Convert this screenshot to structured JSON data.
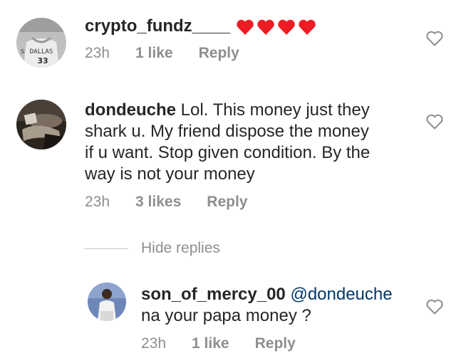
{
  "comments": [
    {
      "username": "crypto_fundz____",
      "text": "",
      "hearts": 4,
      "time": "23h",
      "likes": "1 like",
      "reply": "Reply",
      "avatar_text": "DALLAS 33",
      "avatar_text_small": "S",
      "avatar_number": "33",
      "avatar_team": "DALLAS"
    },
    {
      "username": "dondeuche",
      "text_lines": [
        " Lol. This money just they",
        "shark u. My friend dispose the money",
        "if u want. Stop given condition. By the",
        "way is not your money"
      ],
      "time": "23h",
      "likes": "3 likes",
      "reply": "Reply"
    }
  ],
  "hide_replies": "Hide replies",
  "reply_comment": {
    "username": "son_of_mercy_00",
    "mention": "@dondeuche",
    "text_line2": "na your papa money ?",
    "time": "23h",
    "likes": "1 like",
    "reply": "Reply"
  },
  "colors": {
    "text": "#262626",
    "meta": "#8e8e8e",
    "mention": "#00376b",
    "heart": "#ed1c24"
  },
  "icons": {
    "like": "heart-outline-icon",
    "emoji": "red-heart-emoji"
  }
}
